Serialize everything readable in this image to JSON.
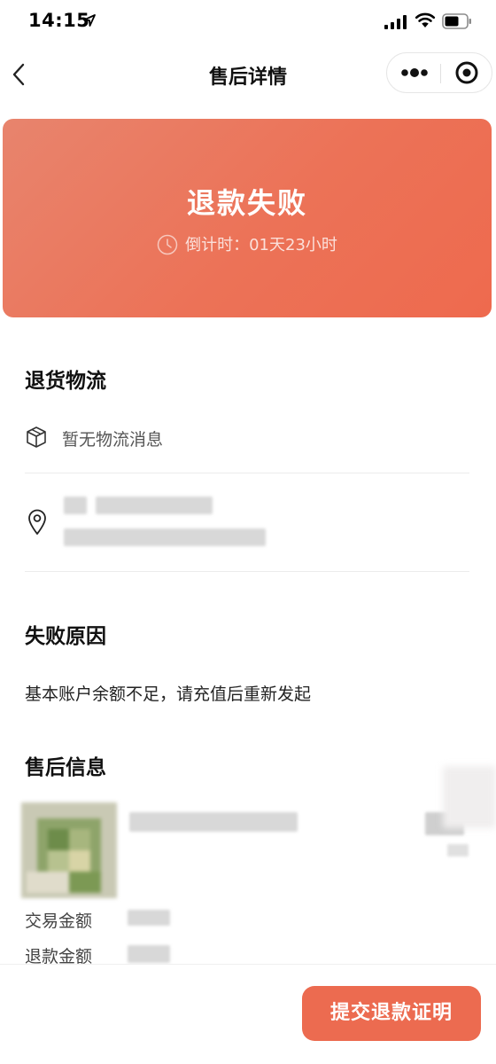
{
  "status_bar": {
    "time": "14:15"
  },
  "nav": {
    "title": "售后详情"
  },
  "banner": {
    "title": "退款失败",
    "countdown": "倒计时：01天23小时"
  },
  "logistics": {
    "title": "退货物流",
    "empty_text": "暂无物流消息"
  },
  "failure": {
    "title": "失败原因",
    "reason": "基本账户余额不足，请充值后重新发起"
  },
  "after_sale": {
    "title": "售后信息",
    "labels": {
      "trade_amount": "交易金额",
      "refund_amount": "退款金额"
    }
  },
  "footer": {
    "submit_label": "提交退款证明"
  },
  "colors": {
    "accent": "#ec6b50",
    "banner_start": "#e8846d",
    "banner_end": "#ee6a4e"
  }
}
